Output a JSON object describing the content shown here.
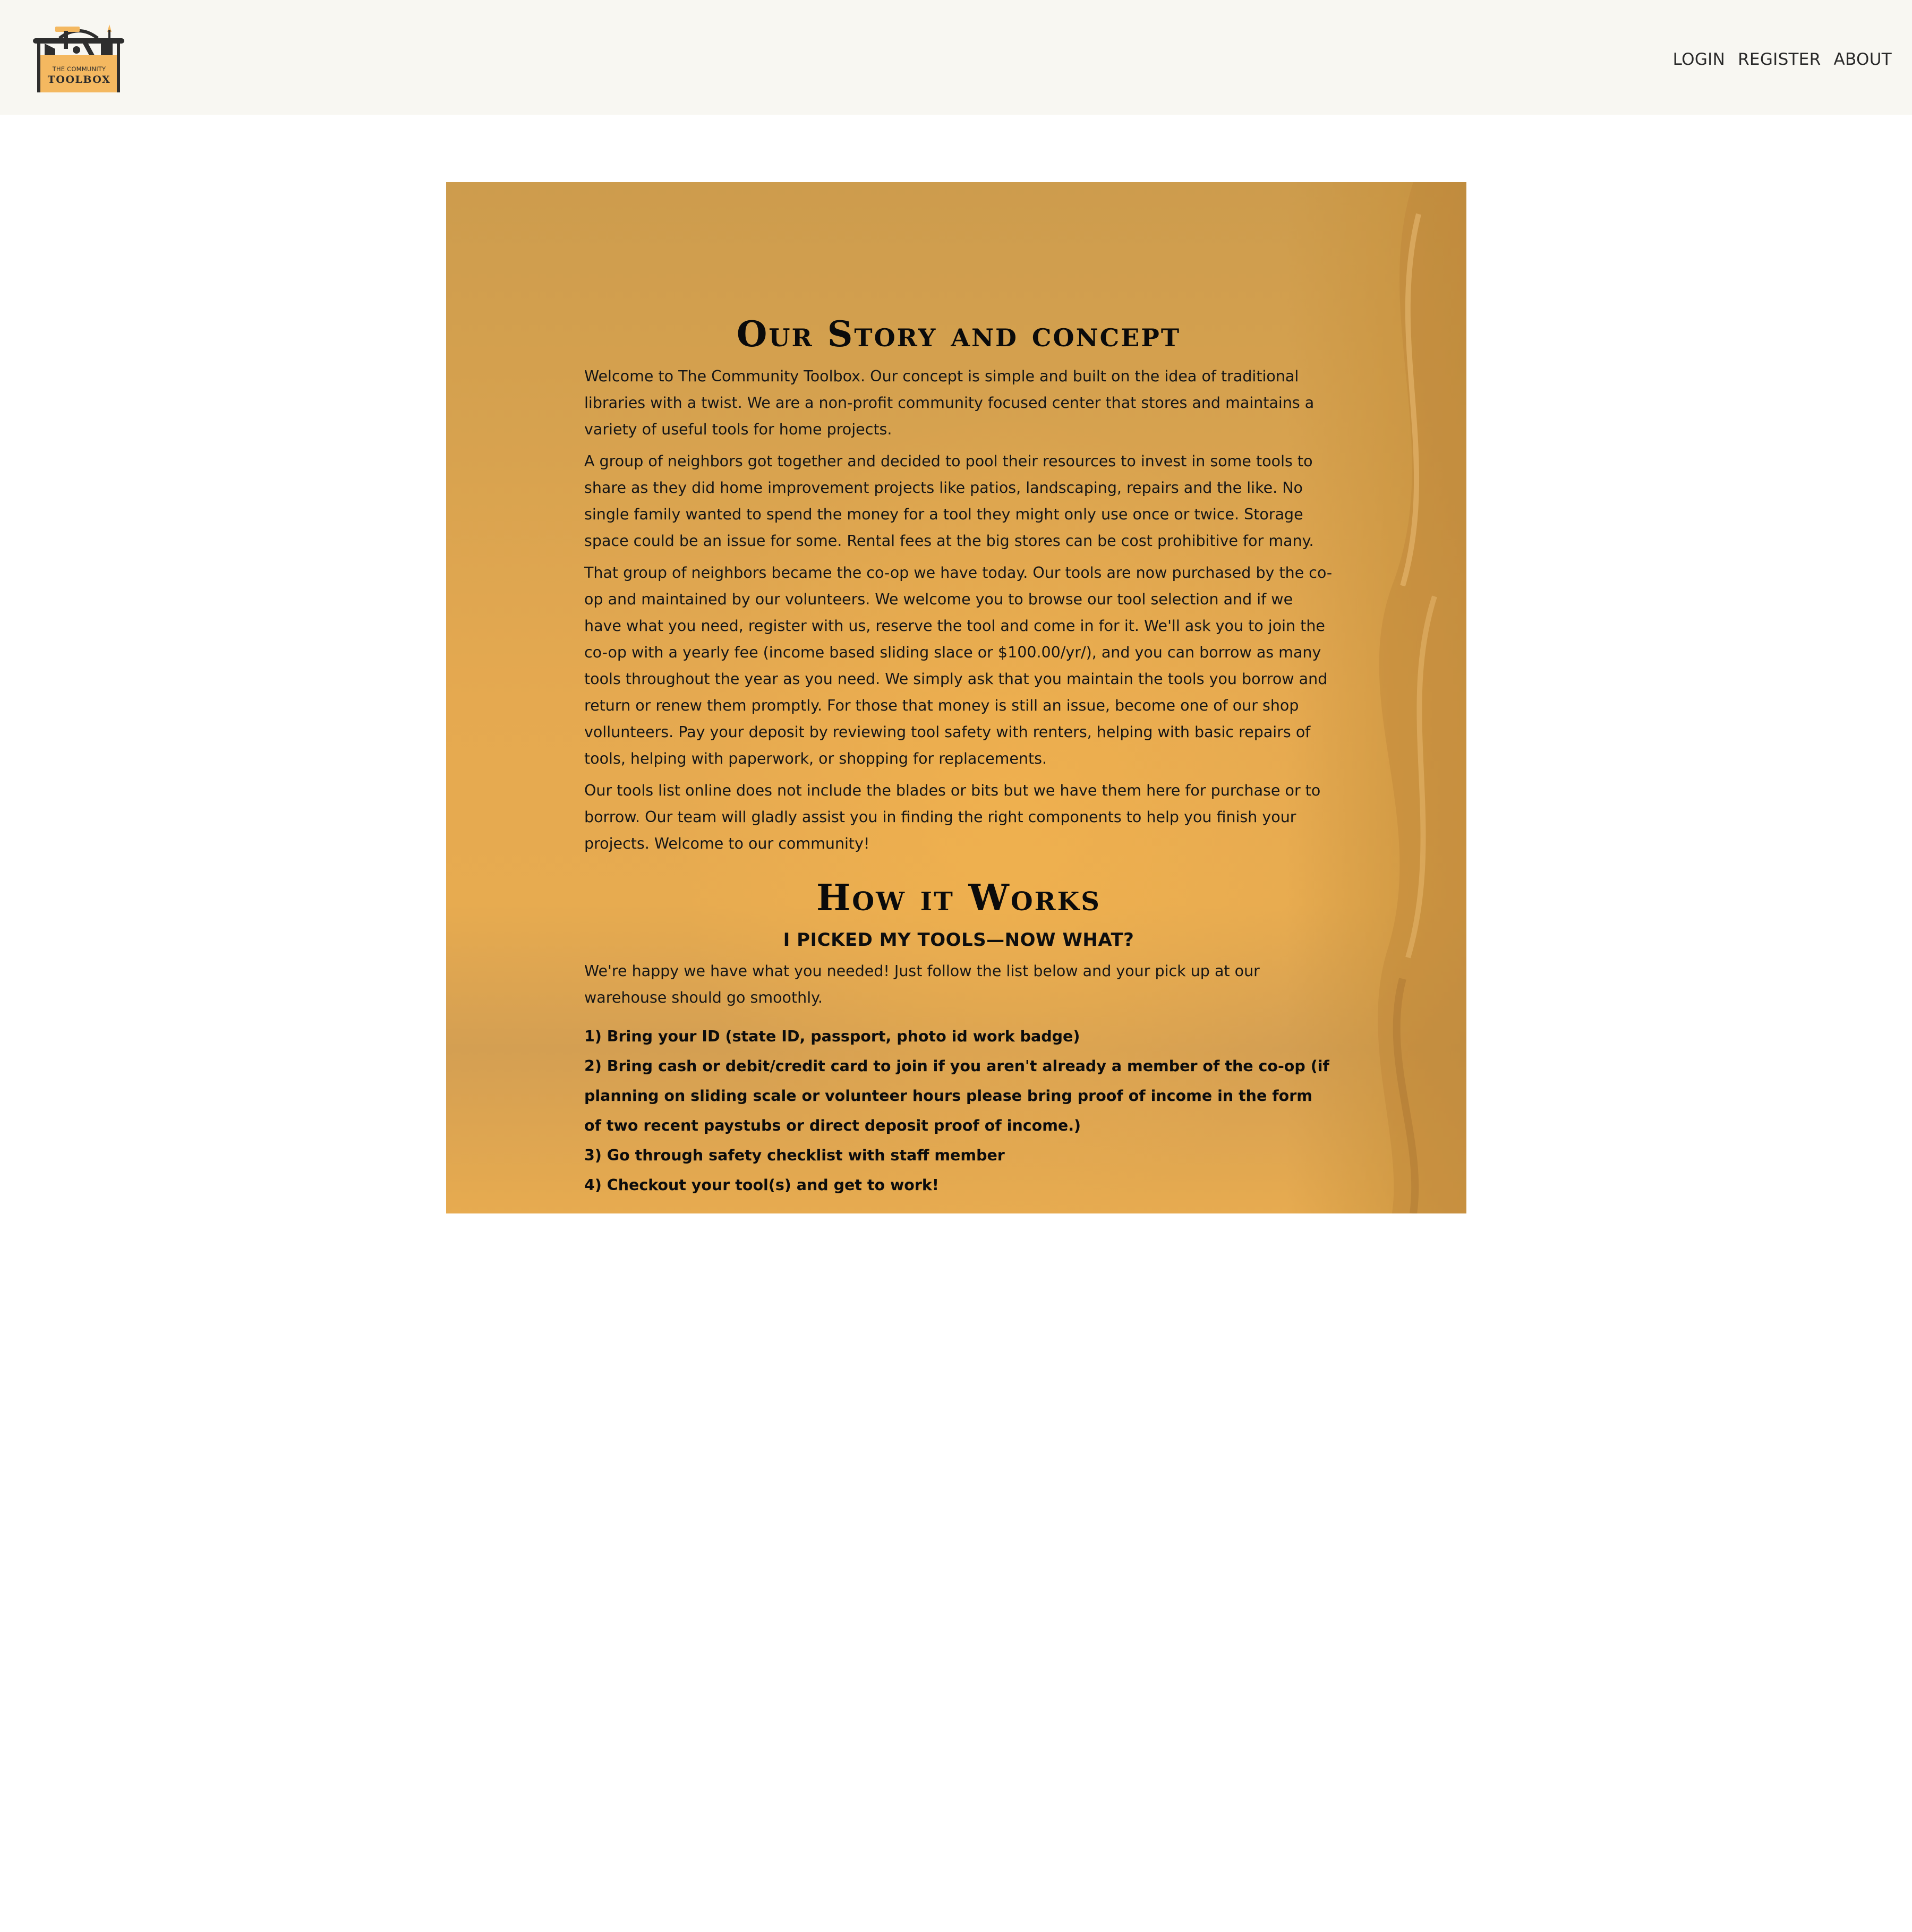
{
  "header": {
    "logo": {
      "line1": "THE COMMUNITY",
      "line2": "TOOLBOX"
    },
    "nav": [
      {
        "label": "LOGIN"
      },
      {
        "label": "REGISTER"
      },
      {
        "label": "ABOUT"
      }
    ]
  },
  "story": {
    "heading": "Our Story and concept",
    "paragraphs": [
      "Welcome to The Community Toolbox. Our concept is simple and built on the idea of traditional libraries with a twist. We are a non-profit community focused center that stores and maintains a variety of useful tools for home projects.",
      "A group of neighbors got together and decided to pool their resources to invest in some tools to share as they did home improvement projects like patios, landscaping, repairs and the like. No single family wanted to spend the money for a tool they might only use once or twice. Storage space could be an issue for some. Rental fees at the big stores can be cost prohibitive for many.",
      "That group of neighbors became the co-op we have today. Our tools are now purchased by the co-op and maintained by our volunteers. We welcome you to browse our tool selection and if we have what you need, register with us, reserve the tool and come in for it. We'll ask you to join the co-op with a yearly fee (income based sliding slace or $100.00/yr/), and you can borrow as many tools throughout the year as you need. We simply ask that you maintain the tools you borrow and return or renew them promptly. For those that money is still an issue, become one of our shop vollunteers. Pay your deposit by reviewing tool safety with renters, helping with basic repairs of tools, helping with paperwork, or shopping for replacements.",
      "Our tools list online does not include the blades or bits but we have them here for purchase or to borrow. Our team will gladly assist you in finding the right components to help you finish your projects. Welcome to our community!"
    ]
  },
  "how": {
    "heading": "How it Works",
    "subheading": "I PICKED MY TOOLS—NOW WHAT?",
    "intro": "We're happy we have what you needed! Just follow the list below and your pick up at our warehouse should go smoothly.",
    "steps": [
      "1) Bring your ID (state ID, passport, photo id work badge)",
      "2) Bring cash or debit/credit card to join if you aren't already a member of the co-op (if planning on sliding scale or volunteer hours please bring proof of income in the form of two recent paystubs or direct deposit proof of income.)",
      "3) Go through safety checklist with staff member",
      "4) Checkout your tool(s) and get to work!"
    ]
  },
  "colors": {
    "header_bg": "#f8f7f2",
    "card_accent": "#e5a950",
    "logo_box": "#f4b860",
    "text": "#161616"
  }
}
